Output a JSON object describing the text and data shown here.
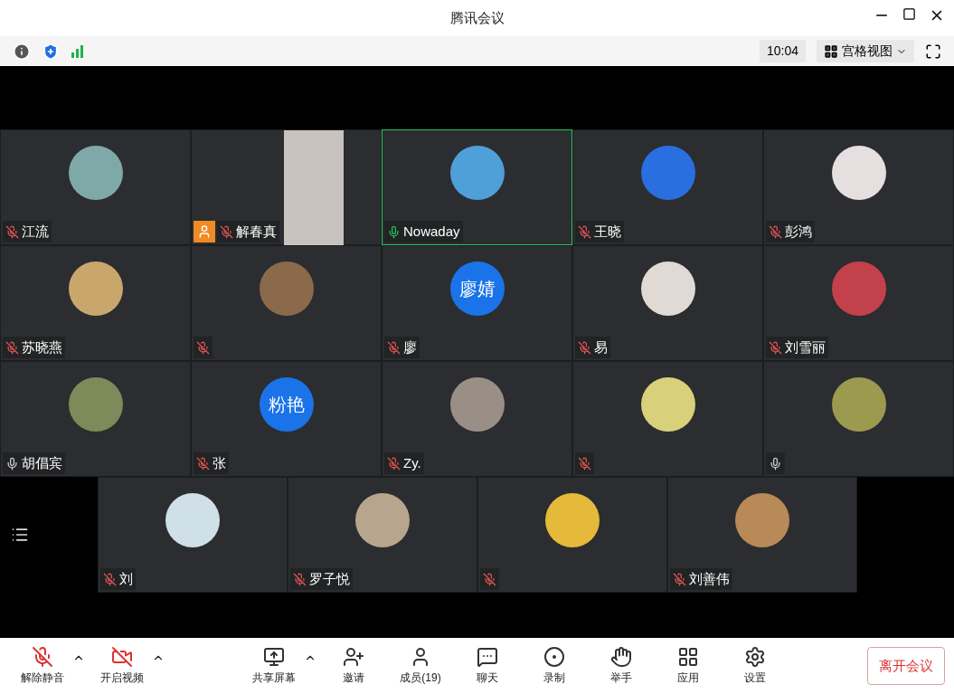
{
  "window": {
    "title": "腾讯会议"
  },
  "topbar": {
    "time": "10:04",
    "view": "宫格视图"
  },
  "tiles": [
    {
      "name": "江流",
      "muted": true,
      "speaking": false,
      "avatar": {
        "kind": "photo",
        "color": "#7fa9a8"
      }
    },
    {
      "name": "解春真",
      "muted": true,
      "speaking": false,
      "avatar": {
        "kind": "video",
        "color": "#c9c3bf"
      }
    },
    {
      "name": "Nowaday",
      "muted": false,
      "speaking": true,
      "avatar": {
        "kind": "photo",
        "color": "#4f9fd8"
      }
    },
    {
      "name": "王晓",
      "muted": true,
      "speaking": false,
      "avatar": {
        "kind": "photo",
        "color": "#2a6fe0"
      }
    },
    {
      "name": "彭鸿",
      "muted": true,
      "speaking": false,
      "avatar": {
        "kind": "photo",
        "color": "#e6dfe0"
      }
    },
    {
      "name": "苏晓燕",
      "muted": true,
      "speaking": false,
      "avatar": {
        "kind": "photo",
        "color": "#c9a66b"
      }
    },
    {
      "muted": true,
      "speaking": false,
      "avatar": {
        "kind": "photo",
        "color": "#8a6a4a"
      }
    },
    {
      "name": "廖",
      "muted": true,
      "speaking": false,
      "avatar": {
        "kind": "text",
        "text": "廖婧",
        "color": "#1a73e8"
      }
    },
    {
      "name": "易",
      "muted": true,
      "speaking": false,
      "avatar": {
        "kind": "photo",
        "color": "#e0d9d4"
      }
    },
    {
      "name": "刘雪丽",
      "muted": true,
      "speaking": false,
      "avatar": {
        "kind": "photo",
        "color": "#c2414b"
      }
    },
    {
      "name": "胡倡宾",
      "muted": false,
      "speaking": false,
      "avatar": {
        "kind": "photo",
        "color": "#7d8a5a"
      }
    },
    {
      "name": "张",
      "muted": true,
      "speaking": false,
      "avatar": {
        "kind": "text",
        "text": "粉艳",
        "color": "#1a73e8"
      }
    },
    {
      "name": "Zy.",
      "muted": true,
      "speaking": false,
      "avatar": {
        "kind": "photo",
        "color": "#9a8f86"
      }
    },
    {
      "muted": true,
      "speaking": false,
      "avatar": {
        "kind": "photo",
        "color": "#d8d07a"
      }
    },
    {
      "muted": false,
      "speaking": false,
      "avatar": {
        "kind": "photo",
        "color": "#9b9a4e"
      }
    },
    {
      "name": "刘",
      "muted": true,
      "speaking": false,
      "avatar": {
        "kind": "photo",
        "color": "#cfe0e8"
      }
    },
    {
      "name": "罗子悦",
      "muted": true,
      "speaking": false,
      "avatar": {
        "kind": "photo",
        "color": "#b7a58e"
      }
    },
    {
      "muted": true,
      "speaking": false,
      "avatar": {
        "kind": "photo",
        "color": "#e5b93a"
      }
    },
    {
      "name": "刘善伟",
      "muted": true,
      "speaking": false,
      "avatar": {
        "kind": "photo",
        "color": "#b88a57"
      }
    }
  ],
  "toolbar": [
    {
      "kind": "mic",
      "label": "解除静音",
      "caret": true
    },
    {
      "kind": "video",
      "label": "开启视频",
      "caret": true
    },
    {
      "kind": "share",
      "label": "共享屏幕",
      "caret": true
    },
    {
      "kind": "invite",
      "label": "邀请",
      "caret": false
    },
    {
      "kind": "members",
      "label": "成员(19)",
      "caret": false
    },
    {
      "kind": "chat",
      "label": "聊天",
      "caret": false
    },
    {
      "kind": "record",
      "label": "录制",
      "caret": false
    },
    {
      "kind": "hand",
      "label": "举手",
      "caret": false
    },
    {
      "kind": "apps",
      "label": "应用",
      "caret": false
    },
    {
      "kind": "settings",
      "label": "设置",
      "caret": false
    }
  ],
  "leave_button": "离开会议"
}
